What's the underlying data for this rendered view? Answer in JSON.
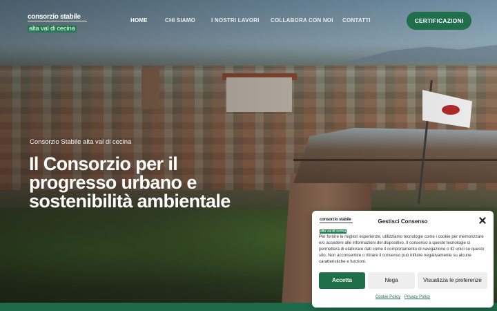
{
  "header": {
    "logo_line1": "consorzio stabile",
    "logo_line2": "alta val di cecina",
    "nav": [
      "HOME",
      "CHI SIAMO",
      "I NOSTRI LAVORI",
      "COLLABORA CON NOI",
      "CONTATTI"
    ],
    "active_nav": "HOME",
    "cta_label": "CERTIFICAZIONI"
  },
  "hero": {
    "kicker": "Consorzio Stabile alta val di cecina",
    "headline_lines": [
      "Il Consorzio per il",
      "progresso urbano e",
      "sostenibilità ambientale"
    ]
  },
  "cookie_banner": {
    "logo_line1": "consorzio stabile",
    "logo_line2": "alta val di cecina",
    "title": "Gestisci Consenso",
    "body": "Per fornire le migliori esperienze, utilizziamo tecnologie come i cookie per memorizzare e/o accedere alle informazioni del dispositivo. Il consenso a queste tecnologie ci permetterà di elaborare dati come il comportamento di navigazione o ID unici su questo sito. Non acconsentire o ritirare il consenso può influire negativamente su alcune caratteristiche e funzioni.",
    "accept_label": "Accetta",
    "deny_label": "Nega",
    "preferences_label": "Visualizza le preferenze",
    "links": [
      "Cookie Policy",
      "Privacy Policy"
    ]
  },
  "colors": {
    "brand_green": "#1e6f4a",
    "white": "#ffffff"
  }
}
